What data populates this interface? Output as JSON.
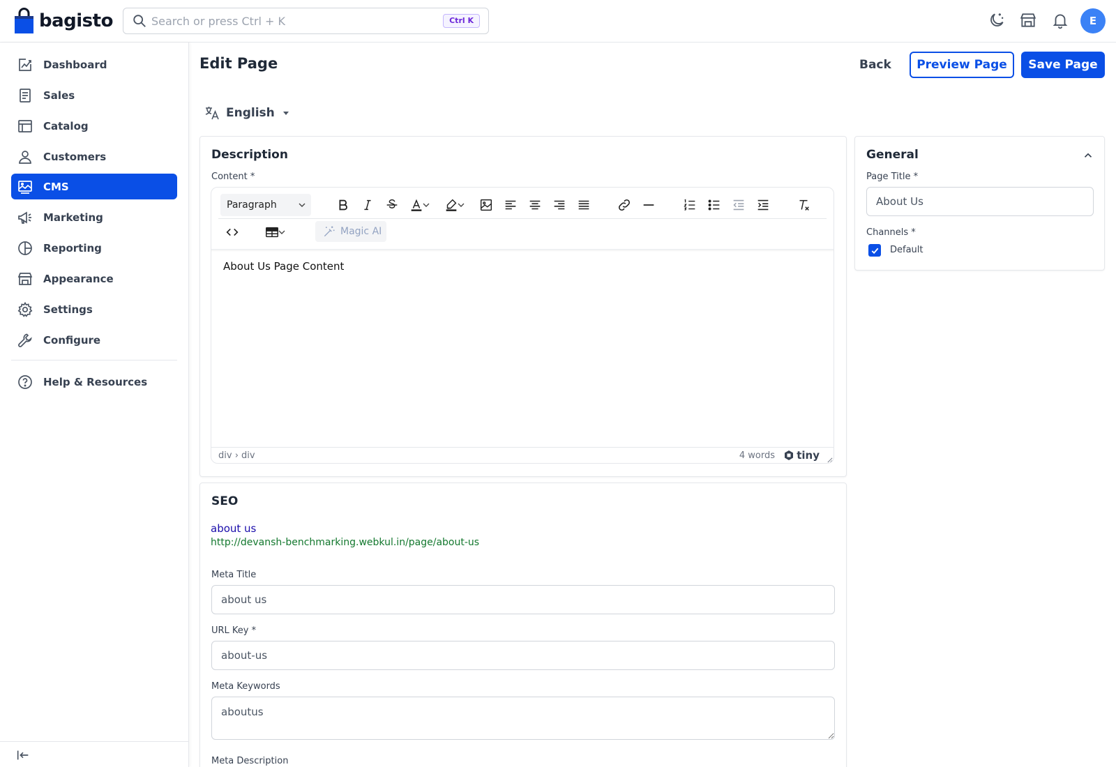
{
  "app": {
    "logo_text": "bagisto",
    "search_placeholder": "Search or press Ctrl + K",
    "search_shortcut": "Ctrl K",
    "avatar_initial": "E"
  },
  "sidebar": {
    "items": [
      {
        "label": "Dashboard",
        "icon": "dashboard-icon",
        "active": false
      },
      {
        "label": "Sales",
        "icon": "sales-icon",
        "active": false
      },
      {
        "label": "Catalog",
        "icon": "catalog-icon",
        "active": false
      },
      {
        "label": "Customers",
        "icon": "customers-icon",
        "active": false
      },
      {
        "label": "CMS",
        "icon": "cms-icon",
        "active": true
      },
      {
        "label": "Marketing",
        "icon": "marketing-icon",
        "active": false
      },
      {
        "label": "Reporting",
        "icon": "reporting-icon",
        "active": false
      },
      {
        "label": "Appearance",
        "icon": "appearance-icon",
        "active": false
      },
      {
        "label": "Settings",
        "icon": "settings-icon",
        "active": false
      },
      {
        "label": "Configure",
        "icon": "configure-icon",
        "active": false
      }
    ],
    "help_label": "Help & Resources"
  },
  "header": {
    "title": "Edit Page",
    "back_label": "Back",
    "preview_label": "Preview Page",
    "save_label": "Save Page",
    "locale": "English"
  },
  "description": {
    "title": "Description",
    "content_label": "Content *",
    "format_select": "Paragraph",
    "magic_ai_label": "Magic AI",
    "editor_content": "About Us Page Content",
    "status_path": "div › div",
    "word_count": "4 words",
    "brand": "tiny"
  },
  "seo": {
    "title": "SEO",
    "preview_title": "about us",
    "preview_url": "http://devansh-benchmarking.webkul.in/page/about-us",
    "meta_title_label": "Meta Title",
    "meta_title_value": "about us",
    "url_key_label": "URL Key *",
    "url_key_value": "about-us",
    "meta_keywords_label": "Meta Keywords",
    "meta_keywords_value": "aboutus",
    "meta_description_label": "Meta Description"
  },
  "general": {
    "title": "General",
    "page_title_label": "Page Title *",
    "page_title_value": "About Us",
    "channels_label": "Channels *",
    "channel_option": "Default",
    "channel_checked": true
  },
  "colors": {
    "primary": "#0a4fe6",
    "seo_title": "#1a0dab",
    "seo_url": "#13782e",
    "avatar": "#3b82f6"
  }
}
